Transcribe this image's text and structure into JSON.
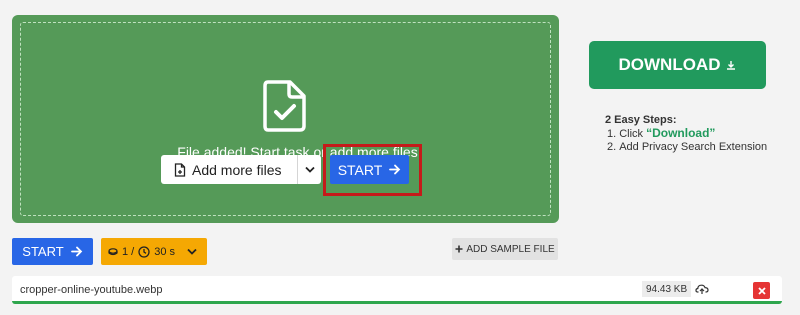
{
  "upload": {
    "message": "File added! Start task or add more files",
    "add_more_label": "Add more files",
    "start_label": "START"
  },
  "sidebar": {
    "download_label": "DOWNLOAD",
    "steps_title": "2 Easy Steps:",
    "steps": [
      {
        "num": "1.",
        "prefix": "Click ",
        "highlight": "“Download”",
        "suffix": ""
      },
      {
        "num": "2.",
        "prefix": "Add Privacy Search Extension",
        "highlight": "",
        "suffix": ""
      }
    ]
  },
  "toolbar": {
    "start_label": "START",
    "quota_count": "1 /",
    "quota_time": "30 s",
    "add_sample_label": "ADD SAMPLE FILE"
  },
  "file": {
    "name": "cropper-online-youtube.webp",
    "size": "94.43 KB"
  },
  "colors": {
    "drop_area": "#559a58",
    "primary_blue": "#2866e6",
    "download_green": "#219a5d",
    "quota_orange": "#f5a803",
    "remove_red": "#e53434",
    "highlight_red": "#c51a1a"
  },
  "icons": {
    "file_check": "file-check-icon",
    "add_file": "file-plus-icon",
    "chevron": "chevron-down-icon",
    "arrow": "arrow-right-icon",
    "download": "download-icon",
    "coin": "coin-icon",
    "clock": "clock-icon",
    "plus": "plus-icon",
    "storage": "cloud-icon",
    "close": "close-icon"
  }
}
